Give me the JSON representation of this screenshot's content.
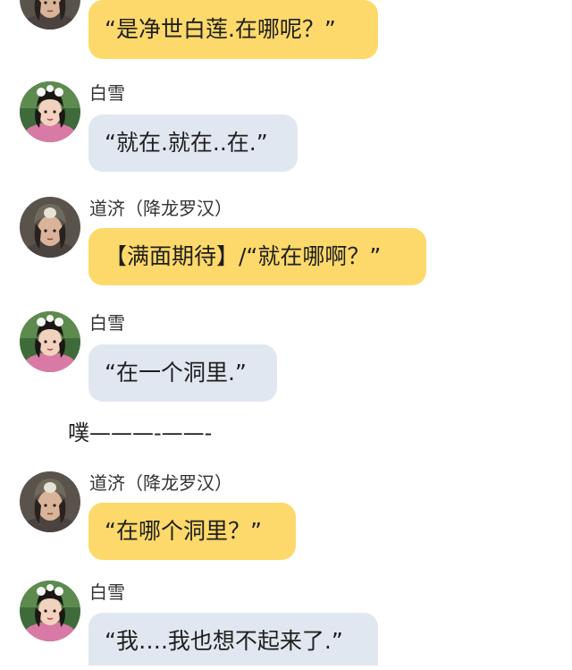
{
  "colors": {
    "bubble_yellow": "#fcd96a",
    "bubble_gray": "#e1e7f0",
    "text": "#1f1f1f"
  },
  "messages": [
    {
      "sender": "",
      "text": "“是净世白莲.在哪呢？”",
      "style": "yellow",
      "avatar": "daoji-avatar"
    },
    {
      "sender": "白雪",
      "text": "“就在.就在..在.”",
      "style": "gray",
      "avatar": "baixue-avatar"
    },
    {
      "sender": "道济（降龙罗汉）",
      "text": "【满面期待】/“就在哪啊？”",
      "style": "yellow",
      "avatar": "daoji-avatar"
    },
    {
      "sender": "白雪",
      "text": "“在一个洞里.”",
      "style": "gray",
      "avatar": "baixue-avatar"
    },
    {
      "sender": "道济（降龙罗汉）",
      "text": "“在哪个洞里？”",
      "style": "yellow",
      "avatar": "daoji-avatar"
    },
    {
      "sender": "白雪",
      "text": "“我….我也想不起来了.”",
      "style": "gray",
      "avatar": "baixue-avatar"
    }
  ],
  "narration": "噗———-——-"
}
